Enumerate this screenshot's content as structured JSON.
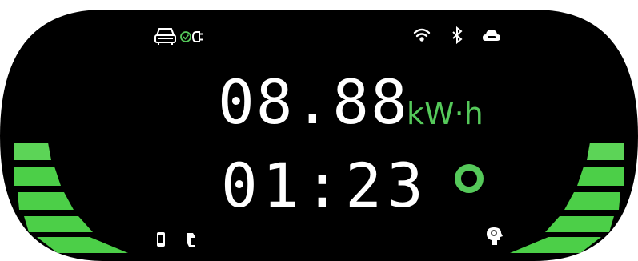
{
  "display": {
    "energy_value": "08.88",
    "energy_unit": "kW·h",
    "time_value": "01:23"
  },
  "status_icons": {
    "top_left": [
      "car-icon",
      "check-circle-icon",
      "plug-icon"
    ],
    "top_right": [
      "wifi-icon",
      "bluetooth-icon",
      "cloud-icon"
    ],
    "bottom_left": [
      "phone-icon",
      "rfid-card-icon"
    ],
    "bottom_right": [
      "service-head-icon"
    ],
    "center": [
      "charging-ring-icon"
    ]
  },
  "charge_bars": {
    "left_lit": 5,
    "right_lit": 5
  },
  "colors": {
    "background": "#000000",
    "segment": "#ffffff",
    "accent_green": "#55c95a",
    "bar_green": "#4ccf48",
    "bar_green_light": "#7ee07a"
  }
}
